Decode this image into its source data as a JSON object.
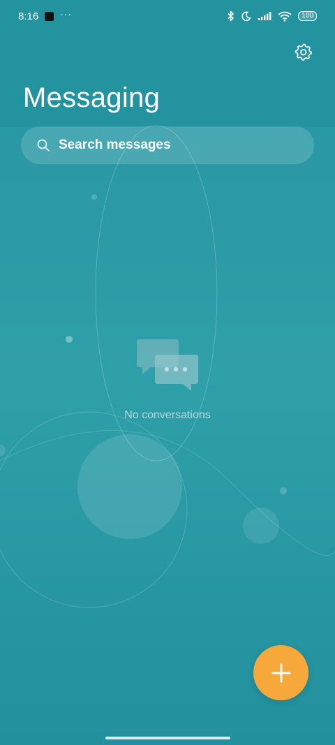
{
  "status_bar": {
    "time": "8:16",
    "more": "···",
    "battery": "100",
    "icons": [
      "app-notification-icon",
      "bluetooth-icon",
      "do-not-disturb-moon-icon",
      "signal-icon",
      "wifi-icon",
      "battery-icon"
    ]
  },
  "header": {
    "title": "Messaging",
    "settings_icon": "gear-icon"
  },
  "search": {
    "placeholder": "Search messages",
    "icon": "search-icon"
  },
  "empty_state": {
    "icon": "chat-bubbles-icon",
    "text": "No conversations"
  },
  "fab": {
    "icon": "plus-icon",
    "color": "#f6a83a"
  },
  "theme": {
    "background": "#2898a4",
    "accent": "#f6a83a"
  }
}
